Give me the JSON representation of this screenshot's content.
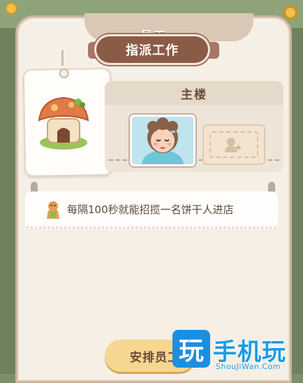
{
  "header": {
    "title": "员工"
  },
  "ribbon": {
    "label": "指派工作"
  },
  "building": {
    "name": "主楼"
  },
  "info": {
    "text": "每隔100秒就能招揽一名饼干人进店"
  },
  "actions": {
    "assign_label": "安排员工"
  },
  "icons": {
    "shop": "mushroom-house-icon",
    "worker": "worker-portrait",
    "empty": "add-person-icon",
    "info": "gingerbread-icon"
  },
  "colors": {
    "panel": "#f6efe6",
    "ribbon": "#8a5b46",
    "button": "#f6d690",
    "text_dark": "#6b4a3a"
  }
}
